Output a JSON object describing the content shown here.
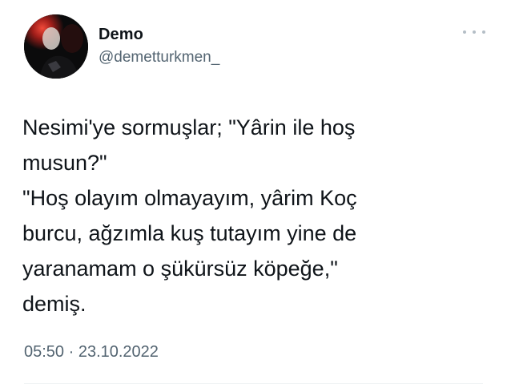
{
  "author": {
    "name": "Demo",
    "handle": "@demetturkmen_",
    "avatar_icon": "profile-photo"
  },
  "more_icon": "more-horizontal-icon",
  "tweet": {
    "lines": [
      "Nesimi'ye sormuşlar; \"Yârin ile hoş",
      "musun?\"",
      "\"Hoş olayım olmayayım, yârim Koç",
      "burcu, ağzımla kuş tutayım yine de",
      "yaranamam o şükürsüz köpeğe,\"",
      "demiş."
    ]
  },
  "meta": {
    "timestamp": "05:50 · 23.10.2022"
  },
  "colors": {
    "text": "#0f1419",
    "secondary": "#536471",
    "dots": "#b4bec6",
    "divider": "#eff3f4"
  }
}
